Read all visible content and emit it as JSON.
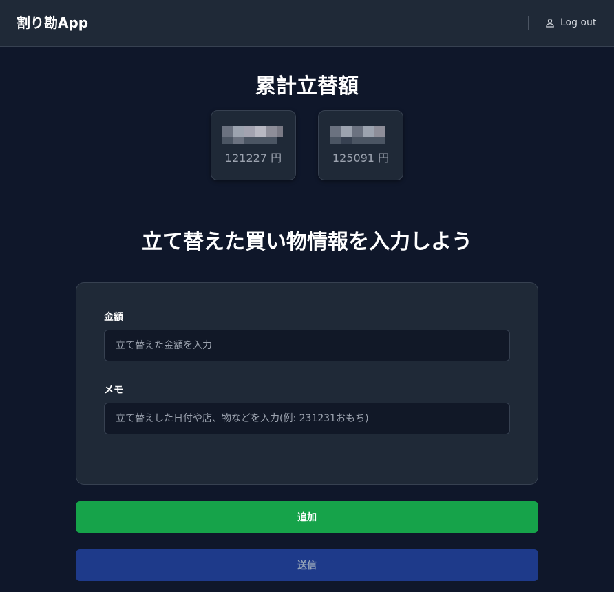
{
  "header": {
    "brand": "割り勘App",
    "logout_label": "Log out"
  },
  "summary": {
    "title": "累計立替額",
    "cards": [
      {
        "amount": "121227 円"
      },
      {
        "amount": "125091 円"
      }
    ]
  },
  "form": {
    "title": "立て替えた買い物情報を入力しよう",
    "amount_label": "金額",
    "amount_placeholder": "立て替えた金額を入力",
    "memo_label": "メモ",
    "memo_placeholder": "立て替えした日付や店、物などを入力(例: 231231おもち)"
  },
  "buttons": {
    "add_label": "追加",
    "send_label": "送信"
  },
  "colors": {
    "background": "#0f172a",
    "panel": "#1f2937",
    "add_button": "#16a34a",
    "send_button": "#1e3a8a"
  }
}
